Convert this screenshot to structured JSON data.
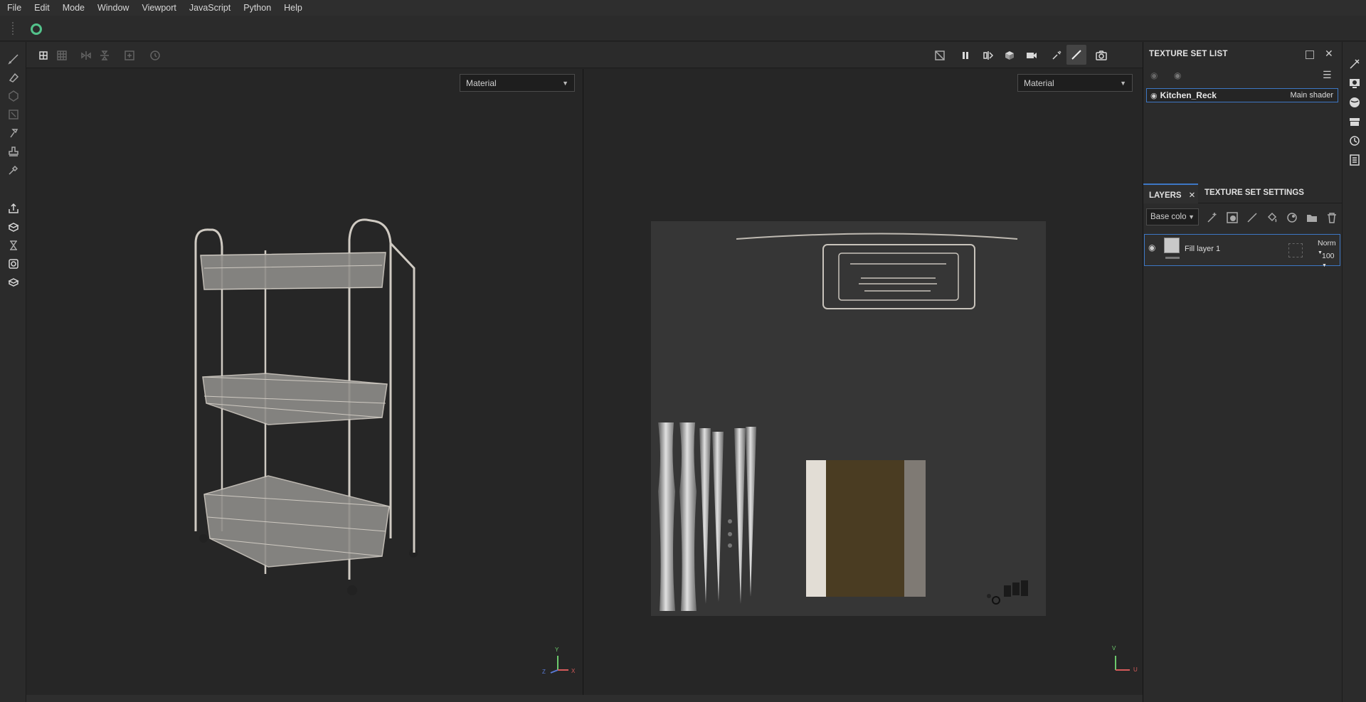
{
  "menu": [
    "File",
    "Edit",
    "Mode",
    "Window",
    "Viewport",
    "JavaScript",
    "Python",
    "Help"
  ],
  "viewports": {
    "left": {
      "material_dropdown": "Material",
      "axis_y": "Y",
      "axis_x": "X",
      "axis_z": "Z"
    },
    "right": {
      "material_dropdown": "Material",
      "axis_v": "V",
      "axis_u": "U"
    }
  },
  "texture_set_list": {
    "title": "TEXTURE SET LIST",
    "items": [
      {
        "name": "Kitchen_Reck",
        "shader": "Main shader"
      }
    ]
  },
  "layers_panel": {
    "tabs": [
      "LAYERS",
      "TEXTURE SET SETTINGS"
    ],
    "channel_dropdown": "Base colo",
    "layers": [
      {
        "name": "Fill layer 1",
        "blend": "Norm",
        "opacity": "100"
      }
    ]
  },
  "colors": {
    "accent": "#3d77c4",
    "plugin_green": "#53c28b",
    "bg": "#252525"
  },
  "icons": {
    "left_tools": [
      "paint-brush-icon",
      "eraser-icon",
      "projection-icon",
      "polygon-fill-icon",
      "smudge-icon",
      "clone-stamp-icon",
      "color-picker-icon",
      "export-icon",
      "bake-icon",
      "hourglass-icon",
      "screenshot-icon",
      "shelf-icon"
    ],
    "right_strip": [
      "brush-settings-icon",
      "display-settings-icon",
      "environment-icon",
      "shelf-icon",
      "history-icon",
      "log-icon"
    ]
  }
}
